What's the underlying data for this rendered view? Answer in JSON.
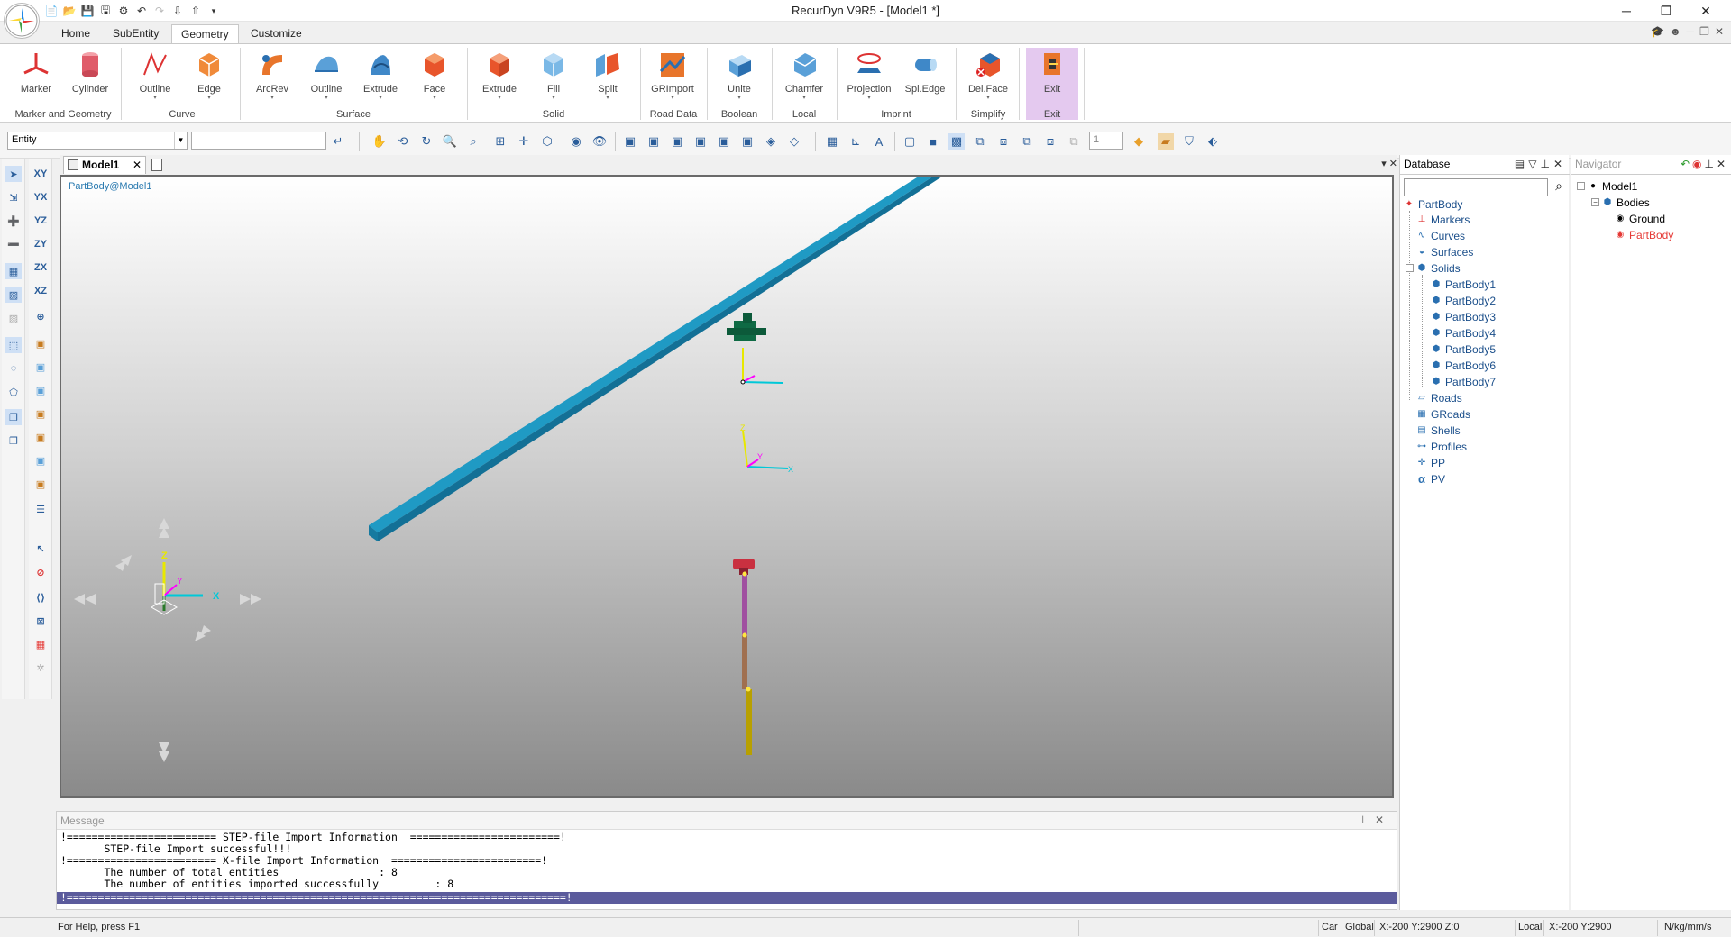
{
  "window": {
    "title": "RecurDyn V9R5  - [Model1 *]"
  },
  "ribbon": {
    "tabs": [
      "Home",
      "SubEntity",
      "Geometry",
      "Customize"
    ],
    "active_tab": "Geometry",
    "buttons": {
      "marker": "Marker",
      "cylinder": "Cylinder",
      "curve_outline": "Outline",
      "curve_edge": "Edge",
      "arcrev": "ArcRev",
      "surface_outline": "Outline",
      "surface_extrude": "Extrude",
      "surface_face": "Face",
      "solid_extrude": "Extrude",
      "solid_fill": "Fill",
      "solid_split": "Split",
      "grimport": "GRImport",
      "unite": "Unite",
      "chamfer": "Chamfer",
      "projection": "Projection",
      "spledge": "Spl.Edge",
      "delface": "Del.Face",
      "exit": "Exit"
    },
    "groups": {
      "marker_geometry": "Marker and Geometry",
      "curve": "Curve",
      "surface": "Surface",
      "solid": "Solid",
      "road_data": "Road Data",
      "boolean": "Boolean",
      "local": "Local",
      "imprint": "Imprint",
      "simplify": "Simplify",
      "exit": "Exit"
    }
  },
  "toolbar": {
    "entity_select": "Entity",
    "entity_input": "",
    "page_number": "1"
  },
  "document": {
    "tab": "Model1",
    "viewport_path": "PartBody@Model1"
  },
  "scene": {
    "axis_x": "X",
    "axis_y": "Y",
    "axis_z": "Z",
    "marker_x": "X",
    "marker_y": "Y",
    "marker_z": "Z"
  },
  "database": {
    "title": "Database",
    "search_value": "",
    "root": "PartBody",
    "items": [
      "Markers",
      "Curves",
      "Surfaces",
      "Solids"
    ],
    "solids": [
      "PartBody1",
      "PartBody2",
      "PartBody3",
      "PartBody4",
      "PartBody5",
      "PartBody6",
      "PartBody7"
    ],
    "other_items": [
      "Roads",
      "GRoads",
      "Shells",
      "Profiles",
      "PP",
      "PV"
    ]
  },
  "navigator": {
    "title": "Navigator",
    "model": "Model1",
    "bodies": "Bodies",
    "ground": "Ground",
    "partbody": "PartBody"
  },
  "message": {
    "title": "Message",
    "lines": [
      "!======================== STEP-file Import Information  ========================!",
      "       STEP-file Import successful!!!",
      "!======================== X-file Import Information  ========================!",
      "       The number of total entities                : 8",
      "       The number of entities imported successfully         : 8"
    ],
    "selected_line": "!================================================================================!"
  },
  "statusbar": {
    "help": "For Help, press F1",
    "car": "Car",
    "global": "Global",
    "global_coords": "X:-200 Y:2900 Z:0",
    "local": "Local",
    "local_coords": "X:-200 Y:2900",
    "units": "N/kg/mm/s"
  },
  "colors": {
    "beam": "#1f9ac4",
    "exit_bg": "#e4c9ef",
    "axis_x": "#00c8d8",
    "axis_y": "#ff00ff",
    "axis_z": "#e8e800"
  }
}
